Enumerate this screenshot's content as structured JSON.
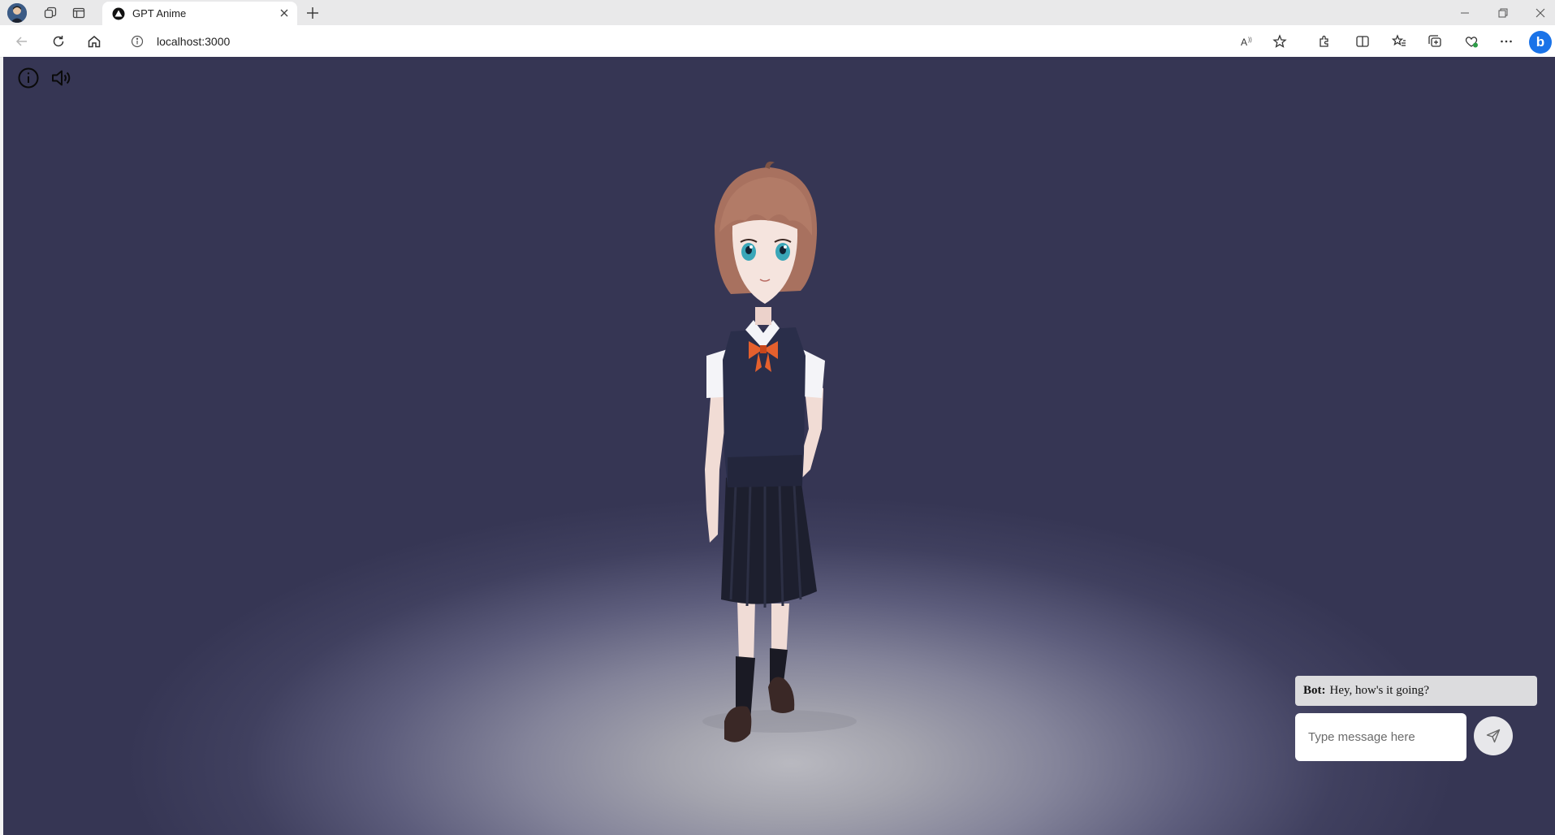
{
  "browser": {
    "tab": {
      "title": "GPT Anime",
      "icon": "app-logo-icon"
    },
    "address_bar": {
      "url": "localhost:3000",
      "icon": "info-icon"
    },
    "toolbar_icons": [
      "read-aloud-icon",
      "favorite-star-icon",
      "extensions-icon",
      "split-screen-icon",
      "favorites-icon",
      "collections-icon",
      "browser-essentials-icon",
      "more-icon",
      "bing-icon"
    ],
    "bing_label": "b"
  },
  "app": {
    "overlay_icons": [
      "info-icon",
      "speaker-icon"
    ],
    "character": "3d-anime-avatar",
    "chat": {
      "bot_label": "Bot:",
      "bot_message": "Hey, how's it going?",
      "input_placeholder": "Type message here",
      "input_value": "",
      "send_icon": "send-icon"
    }
  },
  "colors": {
    "background": "#363654",
    "spotlight": "#b9b9c0",
    "bubble": "#dcdcde"
  }
}
